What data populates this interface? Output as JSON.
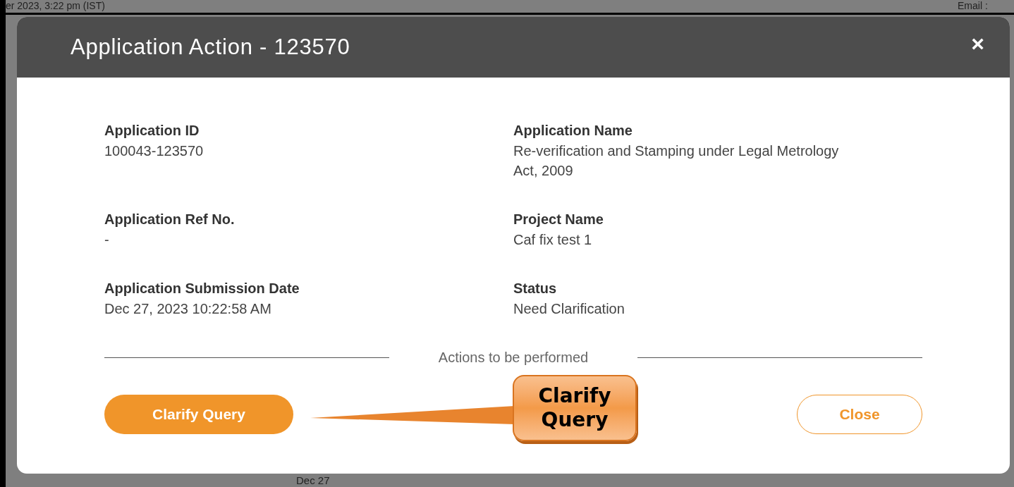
{
  "background": {
    "texts": [
      "er 2023, 3:22 pm (IST)",
      "Email :",
      "Dec 27"
    ]
  },
  "dialog": {
    "title": "Application Action - 123570",
    "close_symbol": "×",
    "fields": [
      {
        "label": "Application ID",
        "value": "100043-123570"
      },
      {
        "label": "Application Name",
        "value": "Re-verification and Stamping under Legal Metrology Act, 2009"
      },
      {
        "label": "Application Ref No.",
        "value": "-"
      },
      {
        "label": "Project Name",
        "value": "Caf fix test 1"
      },
      {
        "label": "Application Submission Date",
        "value": "Dec 27, 2023 10:22:58 AM"
      },
      {
        "label": "Status",
        "value": "Need Clarification"
      }
    ],
    "section_heading": "Actions to be performed",
    "buttons": [
      {
        "label": "Clarify Query",
        "kind": "primary"
      },
      {
        "label": "Close",
        "kind": "outline"
      }
    ]
  },
  "callout": {
    "text": "Clarify Query"
  }
}
